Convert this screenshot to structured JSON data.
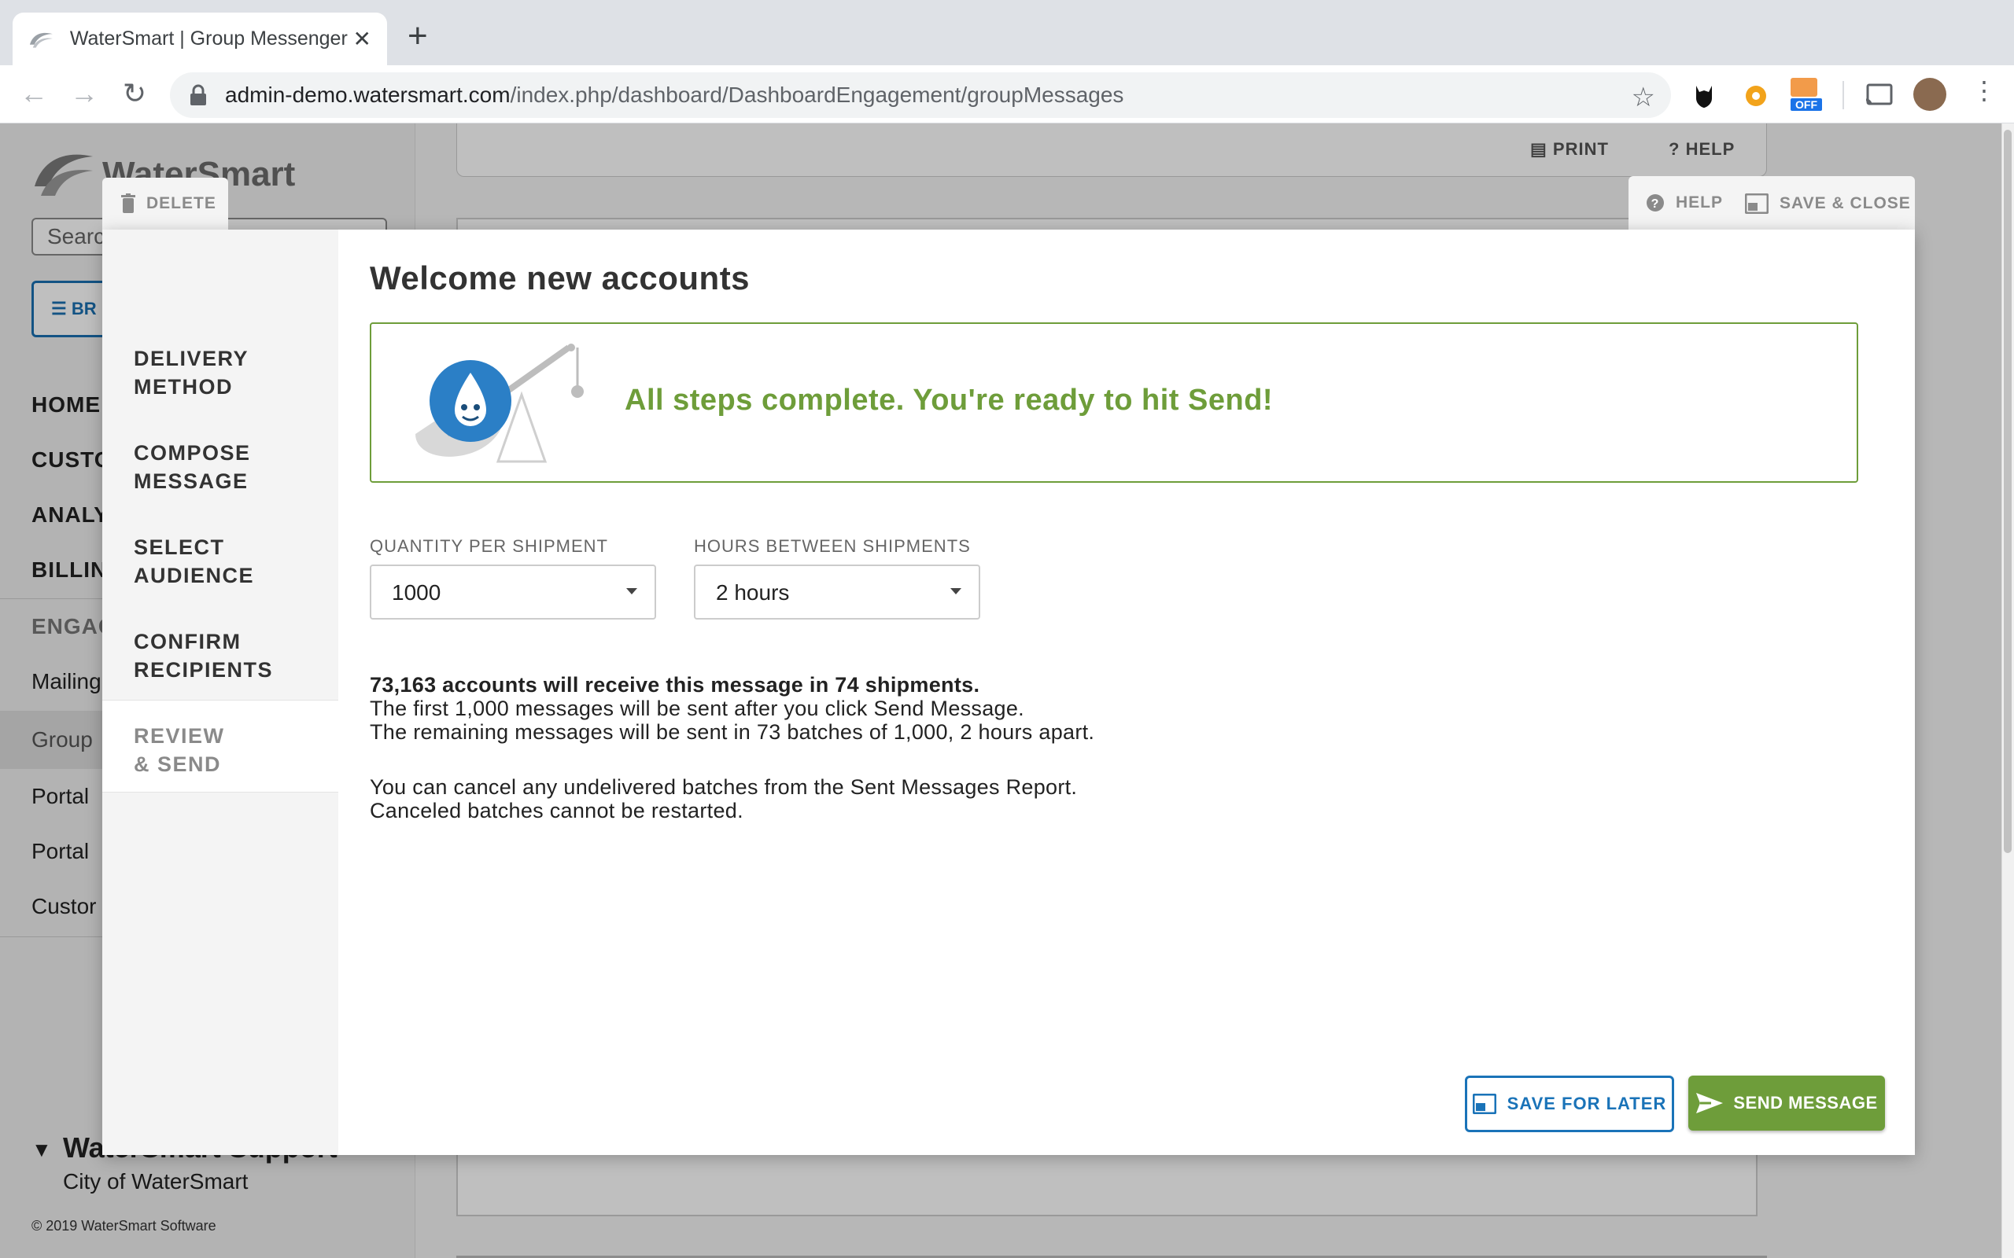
{
  "browser": {
    "tab_title": "WaterSmart | Group Messenger",
    "url_host": "admin-demo.watersmart.com",
    "url_path": "/index.php/dashboard/DashboardEngagement/groupMessages",
    "extension_badge": "OFF"
  },
  "background_app": {
    "brand": "WaterSmart",
    "search_placeholder": "Search",
    "browse_label": "BR",
    "nav": [
      "HOME",
      "CUSTO",
      "ANALY",
      "BILLIN",
      "ENGAG"
    ],
    "sub_nav": [
      "Mailing",
      "Group",
      "Portal",
      "Portal",
      "Custor"
    ],
    "topbar": {
      "print": "PRINT",
      "help": "HELP"
    },
    "user_name": "WaterSmart Support",
    "user_org": "City of WaterSmart",
    "copyright": "© 2019 WaterSmart Software"
  },
  "modal": {
    "delete_label": "DELETE",
    "help_label": "HELP",
    "save_close_label": "SAVE & CLOSE",
    "steps": [
      "DELIVERY\nMETHOD",
      "COMPOSE\nMESSAGE",
      "SELECT\nAUDIENCE",
      "CONFIRM\nRECIPIENTS",
      "REVIEW\n& SEND"
    ],
    "active_step": 4,
    "title": "Welcome new accounts",
    "ready_text": "All steps complete. You're ready to hit Send!",
    "quantity_label": "QUANTITY PER SHIPMENT",
    "quantity_value": "1000",
    "hours_label": "HOURS BETWEEN SHIPMENTS",
    "hours_value": "2 hours",
    "summary_bold": "73,163 accounts will receive this message in 74 shipments.",
    "summary_line2": "The first 1,000 messages will be sent after you click Send Message.",
    "summary_line3": "The remaining messages will be sent in 73 batches of 1,000, 2 hours apart.",
    "cancel_line1": "You can cancel any undelivered batches from the Sent Messages Report.",
    "cancel_line2": "Canceled batches cannot be restarted.",
    "save_later_label": "SAVE FOR LATER",
    "send_label": "SEND MESSAGE"
  },
  "colors": {
    "accent_green": "#6e9d3a",
    "accent_blue": "#1a73b8"
  }
}
